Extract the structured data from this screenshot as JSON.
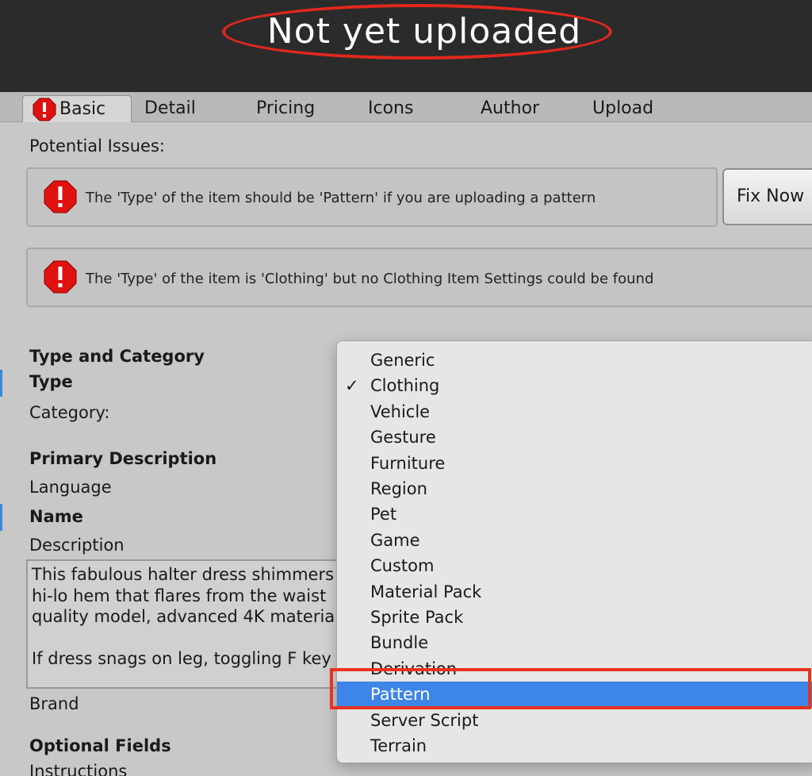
{
  "header": {
    "title": "Not yet uploaded"
  },
  "tabs": [
    {
      "label": "Basic"
    },
    {
      "label": "Detail"
    },
    {
      "label": "Pricing"
    },
    {
      "label": "Icons"
    },
    {
      "label": "Author"
    },
    {
      "label": "Upload"
    }
  ],
  "issues": {
    "heading": "Potential Issues:",
    "items": [
      {
        "text": "The 'Type' of the item should be 'Pattern' if you are uploading a pattern"
      },
      {
        "text": "The 'Type' of the item is 'Clothing' but no Clothing Item Settings could be found"
      }
    ],
    "fix_label": "Fix Now"
  },
  "form": {
    "type_category_heading": "Type and Category",
    "type_label": "Type",
    "category_label": "Category:",
    "primary_heading": "Primary Description",
    "language_label": "Language",
    "name_label": "Name",
    "description_label": "Description",
    "description_value": "This fabulous halter dress shimmers\nhi-lo hem that flares from the waist\nquality model, advanced 4K materia\n\nIf dress snags on leg, toggling F key",
    "brand_label": "Brand",
    "optional_heading": "Optional Fields",
    "instructions_label": "Instructions"
  },
  "dropdown": {
    "items": [
      {
        "label": "Generic"
      },
      {
        "label": "Clothing"
      },
      {
        "label": "Vehicle"
      },
      {
        "label": "Gesture"
      },
      {
        "label": "Furniture"
      },
      {
        "label": "Region"
      },
      {
        "label": "Pet"
      },
      {
        "label": "Game"
      },
      {
        "label": "Custom"
      },
      {
        "label": "Material Pack"
      },
      {
        "label": "Sprite Pack"
      },
      {
        "label": "Bundle"
      },
      {
        "label": "Derivation"
      },
      {
        "label": "Pattern"
      },
      {
        "label": "Server Script"
      },
      {
        "label": "Terrain"
      }
    ],
    "checked_item": "Clothing",
    "highlighted_item": "Pattern",
    "check_glyph": "✓"
  },
  "colors": {
    "accent_blue": "#3d85e8",
    "annotation_red": "#e8321f",
    "error_red": "#e0281c"
  }
}
